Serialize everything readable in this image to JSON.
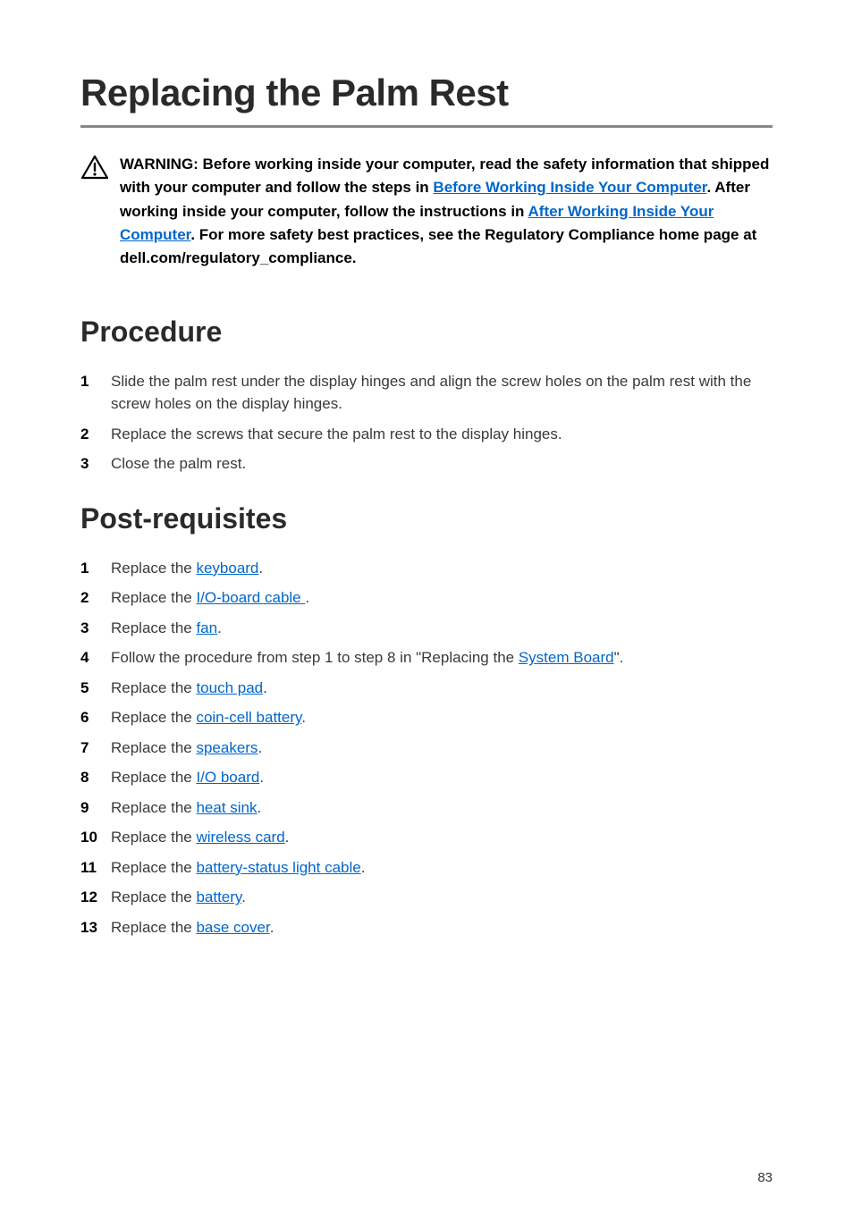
{
  "title": "Replacing the Palm Rest",
  "warning": {
    "prefix": "WARNING: Before working inside your computer, read the safety information that shipped with your computer and follow the steps in ",
    "link1": "Before Working Inside Your Computer",
    "mid1": ". After working inside your computer, follow the instructions in ",
    "link2": "After Working Inside Your Computer",
    "suffix": ". For more safety best practices, see the Regulatory Compliance home page at dell.com/regulatory_compliance."
  },
  "procedure": {
    "heading": "Procedure",
    "steps": [
      {
        "num": "1",
        "text": "Slide the palm rest under the display hinges and align the screw holes on the palm rest with the screw holes on the display hinges."
      },
      {
        "num": "2",
        "text": "Replace the screws that secure the palm rest to the display hinges."
      },
      {
        "num": "3",
        "text": "Close the palm rest."
      }
    ]
  },
  "postreq": {
    "heading": "Post-requisites",
    "prefix": "Replace the ",
    "follow_prefix": "Follow the procedure from step 1 to step 8 in \"Replacing the ",
    "follow_suffix": "\".",
    "steps": [
      {
        "num": "1",
        "link": "keyboard",
        "suffix": "."
      },
      {
        "num": "2",
        "link": "I/O-board cable ",
        "suffix": "."
      },
      {
        "num": "3",
        "link": "fan",
        "suffix": "."
      },
      {
        "num": "4",
        "type": "follow",
        "link": "System Board"
      },
      {
        "num": "5",
        "link": "touch pad",
        "suffix": "."
      },
      {
        "num": "6",
        "link": "coin-cell battery",
        "suffix": "."
      },
      {
        "num": "7",
        "link": "speakers",
        "suffix": "."
      },
      {
        "num": "8",
        "link": "I/O board",
        "suffix": "."
      },
      {
        "num": "9",
        "link": "heat sink",
        "suffix": "."
      },
      {
        "num": "10",
        "link": "wireless card",
        "suffix": "."
      },
      {
        "num": "11",
        "link": "battery-status light cable",
        "suffix": "."
      },
      {
        "num": "12",
        "link": "battery",
        "suffix": "."
      },
      {
        "num": "13",
        "link": "base cover",
        "suffix": "."
      }
    ]
  },
  "page_number": "83"
}
